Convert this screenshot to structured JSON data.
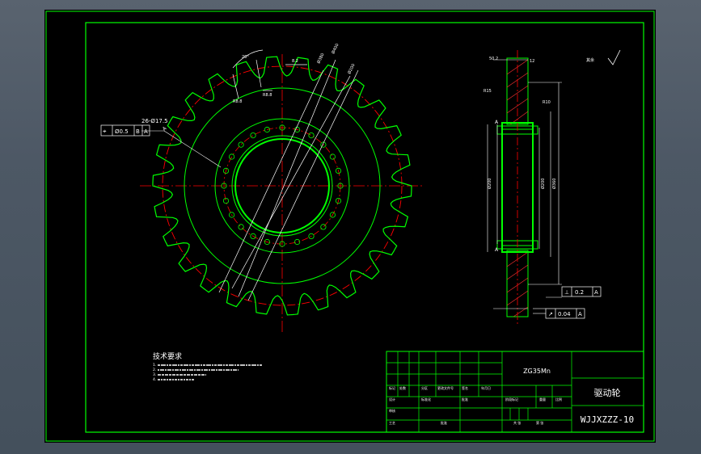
{
  "drawing": {
    "material": "ZG35Mn",
    "part_name": "驱动轮",
    "drawing_no": "WJJXZZZ-10",
    "tech_req_title": "技术要求",
    "tech_req_items": [
      "1.",
      "2.",
      "3.",
      "4."
    ],
    "hole_spec": "26-Ø17.5",
    "position_tol": "Ø0.5",
    "datum_b": "B",
    "datum_a": "A",
    "tol_perp_value": "0.2",
    "tol_runout_value": "0.04",
    "sec_label": "A",
    "colors": {
      "frame": "#00ff00",
      "outline": "#00ff00",
      "center": "#ff0000",
      "dimension": "#ffffff",
      "hatch": "#ff3333"
    }
  }
}
